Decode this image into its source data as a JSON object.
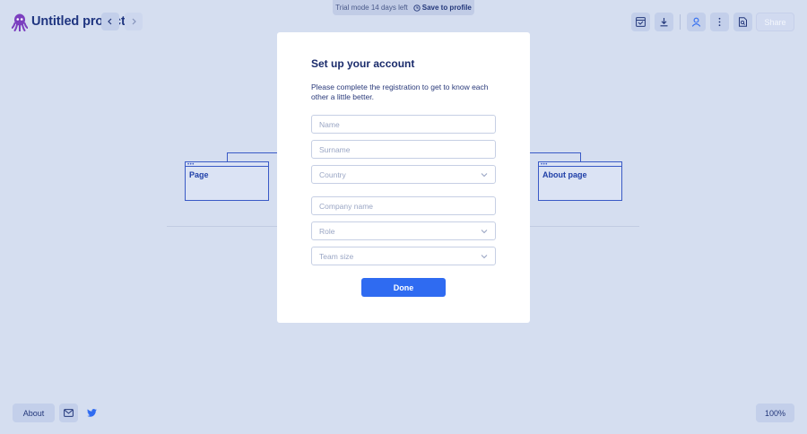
{
  "header": {
    "logo_icon": "octopus-logo-icon",
    "project_title": "Untitled project",
    "trial_text": "Trial mode 14 days left",
    "save_to_profile": "Save to profile",
    "share_label": "Share",
    "tools": [
      "sitemap-icon",
      "download-icon",
      "user-icon",
      "more-vertical-icon",
      "file-search-icon"
    ]
  },
  "canvas": {
    "left_page_label": "Page",
    "right_page_label": "About page"
  },
  "modal": {
    "title": "Set up your account",
    "description": "Please complete the registration to get to know each other a little better.",
    "name_placeholder": "Name",
    "surname_placeholder": "Surname",
    "country_label": "Country",
    "company_placeholder": "Company name",
    "role_label": "Role",
    "team_size_label": "Team size",
    "done_label": "Done"
  },
  "footer": {
    "about_label": "About",
    "zoom_label": "100%"
  },
  "colors": {
    "background": "#d5def0",
    "accent": "#2f6bf1",
    "title": "#1f3580",
    "frame": "#3a5ac6",
    "logo": "#7b3fbf"
  }
}
